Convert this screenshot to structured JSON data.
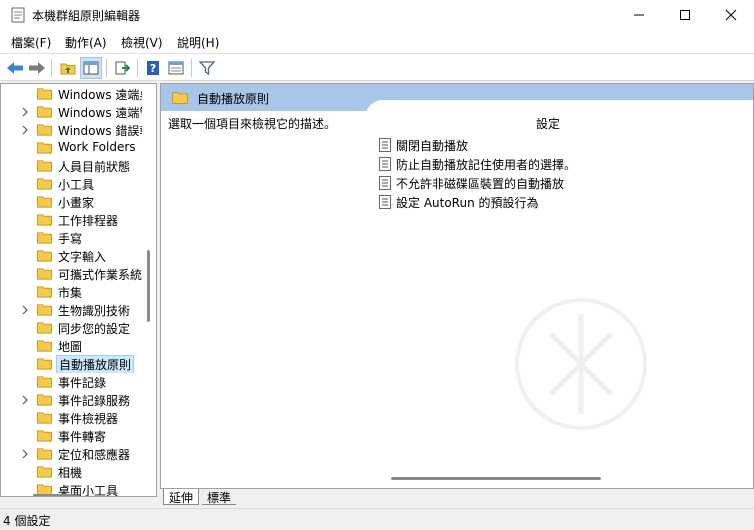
{
  "window": {
    "title": "本機群組原則編輯器",
    "icon": "document-icon"
  },
  "menu": [
    {
      "label": "檔案(F)"
    },
    {
      "label": "動作(A)"
    },
    {
      "label": "檢視(V)"
    },
    {
      "label": "說明(H)"
    }
  ],
  "toolbar": {
    "buttons": [
      "back-arrow-icon",
      "forward-arrow-icon",
      "up-folder-icon",
      "show-hide-tree-icon",
      "export-list-icon",
      "help-icon",
      "properties-view-icon",
      "filter-icon"
    ]
  },
  "tree": {
    "items": [
      {
        "label": "Windows 遠端桌面",
        "expandable": false
      },
      {
        "label": "Windows 遠端管理",
        "expandable": true
      },
      {
        "label": "Windows 錯誤報告",
        "expandable": true
      },
      {
        "label": "Work Folders",
        "expandable": false
      },
      {
        "label": "人員目前狀態",
        "expandable": false
      },
      {
        "label": "小工具",
        "expandable": false
      },
      {
        "label": "小畫家",
        "expandable": false
      },
      {
        "label": "工作排程器",
        "expandable": false
      },
      {
        "label": "手寫",
        "expandable": false
      },
      {
        "label": "文字輸入",
        "expandable": false
      },
      {
        "label": "可攜式作業系統",
        "expandable": false
      },
      {
        "label": "市集",
        "expandable": false
      },
      {
        "label": "生物識別技術",
        "expandable": true
      },
      {
        "label": "同步您的設定",
        "expandable": false
      },
      {
        "label": "地圖",
        "expandable": false
      },
      {
        "label": "自動播放原則",
        "expandable": false,
        "selected": true
      },
      {
        "label": "事件記錄",
        "expandable": false
      },
      {
        "label": "事件記錄服務",
        "expandable": true
      },
      {
        "label": "事件檢視器",
        "expandable": false
      },
      {
        "label": "事件轉寄",
        "expandable": false
      },
      {
        "label": "定位和感應器",
        "expandable": true
      },
      {
        "label": "相機",
        "expandable": false
      },
      {
        "label": "桌面小工具",
        "expandable": false
      }
    ]
  },
  "main": {
    "header_title": "自動播放原則",
    "description": "選取一個項目來檢視它的描述。",
    "column_header": "設定",
    "settings": [
      {
        "label": "關閉自動播放"
      },
      {
        "label": "防止自動播放記住使用者的選擇。"
      },
      {
        "label": "不允許非磁碟區裝置的自動播放"
      },
      {
        "label": "設定 AutoRun 的預設行為"
      }
    ]
  },
  "tabs": [
    {
      "label": "延伸"
    },
    {
      "label": "標準"
    }
  ],
  "status": {
    "text": "4 個設定"
  },
  "colors": {
    "header_band": "#a8c7e8",
    "selection": "#cce8ff",
    "folder": "#f3c94e"
  }
}
